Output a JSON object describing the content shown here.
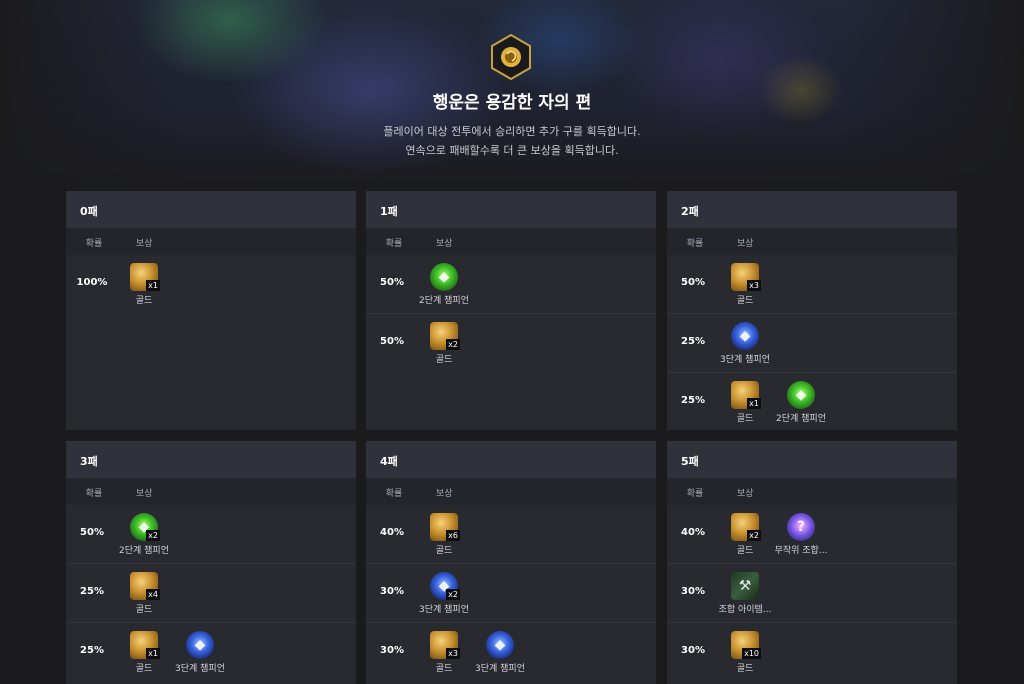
{
  "hero": {
    "title": "행운은 용감한 자의 편",
    "desc_line1": "플레이어 대상 전투에서 승리하면 추가 구를 획득합니다.",
    "desc_line2": "연속으로 패배할수록 더 큰 보상을 획득합니다."
  },
  "headers": {
    "prob": "확률",
    "reward": "보상"
  },
  "cards": [
    {
      "title": "0패",
      "rows": [
        {
          "prob": "100%",
          "rewards": [
            {
              "icon": "gold-icon",
              "qty": "x1",
              "name": "골드"
            }
          ]
        }
      ]
    },
    {
      "title": "1패",
      "rows": [
        {
          "prob": "50%",
          "rewards": [
            {
              "icon": "champion-2star-icon",
              "qty": "",
              "name": "2단계 챔피언"
            }
          ]
        },
        {
          "prob": "50%",
          "rewards": [
            {
              "icon": "gold-icon",
              "qty": "x2",
              "name": "골드"
            }
          ]
        }
      ]
    },
    {
      "title": "2패",
      "rows": [
        {
          "prob": "50%",
          "rewards": [
            {
              "icon": "gold-icon",
              "qty": "x3",
              "name": "골드"
            }
          ]
        },
        {
          "prob": "25%",
          "rewards": [
            {
              "icon": "champion-3star-icon",
              "qty": "",
              "name": "3단계 챔피언"
            }
          ]
        },
        {
          "prob": "25%",
          "rewards": [
            {
              "icon": "gold-icon",
              "qty": "x1",
              "name": "골드"
            },
            {
              "icon": "champion-2star-icon",
              "qty": "",
              "name": "2단계 챔피언"
            }
          ]
        }
      ]
    },
    {
      "title": "3패",
      "rows": [
        {
          "prob": "50%",
          "rewards": [
            {
              "icon": "champion-2star-icon",
              "qty": "x2",
              "name": "2단계 챔피언"
            }
          ]
        },
        {
          "prob": "25%",
          "rewards": [
            {
              "icon": "gold-icon",
              "qty": "x4",
              "name": "골드"
            }
          ]
        },
        {
          "prob": "25%",
          "rewards": [
            {
              "icon": "gold-icon",
              "qty": "x1",
              "name": "골드"
            },
            {
              "icon": "champion-3star-icon",
              "qty": "",
              "name": "3단계 챔피언"
            }
          ]
        }
      ]
    },
    {
      "title": "4패",
      "rows": [
        {
          "prob": "40%",
          "rewards": [
            {
              "icon": "gold-icon",
              "qty": "x6",
              "name": "골드"
            }
          ]
        },
        {
          "prob": "30%",
          "rewards": [
            {
              "icon": "champion-3star-icon",
              "qty": "x2",
              "name": "3단계 챔피언"
            }
          ]
        },
        {
          "prob": "30%",
          "rewards": [
            {
              "icon": "gold-icon",
              "qty": "x3",
              "name": "골드"
            },
            {
              "icon": "champion-3star-icon",
              "qty": "",
              "name": "3단계 챔피언"
            }
          ]
        }
      ]
    },
    {
      "title": "5패",
      "rows": [
        {
          "prob": "40%",
          "rewards": [
            {
              "icon": "gold-icon",
              "qty": "x2",
              "name": "골드"
            },
            {
              "icon": "random-item-icon",
              "qty": "",
              "name": "무작위 조합..."
            }
          ]
        },
        {
          "prob": "30%",
          "rewards": [
            {
              "icon": "craft-item-icon",
              "qty": "",
              "name": "조합 아이템..."
            }
          ]
        },
        {
          "prob": "30%",
          "rewards": [
            {
              "icon": "gold-icon",
              "qty": "x10",
              "name": "골드"
            }
          ]
        }
      ]
    }
  ]
}
